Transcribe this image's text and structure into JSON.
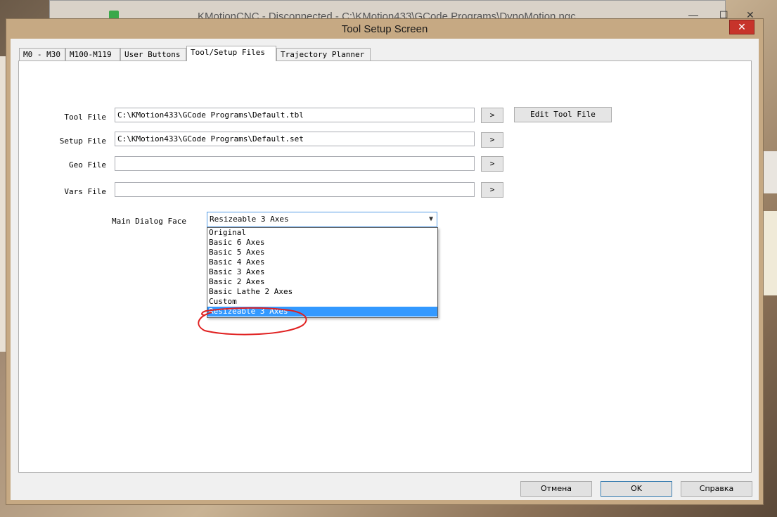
{
  "background_window": {
    "title": "KMotionCNC - Disconnected - C:\\KMotion433\\GCode Programs\\DynoMotion.ngc"
  },
  "dialog": {
    "title": "Tool Setup Screen",
    "close_label": "✕"
  },
  "tabs": [
    {
      "label": "M0 - M30"
    },
    {
      "label": "M100-M119"
    },
    {
      "label": "User Buttons"
    },
    {
      "label": "Tool/Setup Files"
    },
    {
      "label": "Trajectory Planner"
    }
  ],
  "active_tab": "Tool/Setup Files",
  "files": {
    "tool": {
      "label": "Tool File",
      "value": "C:\\KMotion433\\GCode Programs\\Default.tbl",
      "browse": ">"
    },
    "setup": {
      "label": "Setup File",
      "value": "C:\\KMotion433\\GCode Programs\\Default.set",
      "browse": ">"
    },
    "geo": {
      "label": "Geo File",
      "value": "",
      "browse": ">"
    },
    "vars": {
      "label": "Vars File",
      "value": "",
      "browse": ">"
    },
    "edit_tool_file_label": "Edit Tool File"
  },
  "main_dialog_face": {
    "label": "Main Dialog Face",
    "selected": "Resizeable 3 Axes",
    "options": [
      "Original",
      "Basic 6 Axes",
      "Basic 5 Axes",
      "Basic 4 Axes",
      "Basic 3 Axes",
      "Basic 2 Axes",
      "Basic Lathe 2 Axes",
      "Custom",
      "Resizeable 3 Axes"
    ]
  },
  "footer": {
    "cancel_label": "Отмена",
    "ok_label": "OK",
    "help_label": "Справка"
  },
  "colors": {
    "highlight": "#3399ff",
    "annotation": "#e02020",
    "close_button": "#c7342b"
  }
}
